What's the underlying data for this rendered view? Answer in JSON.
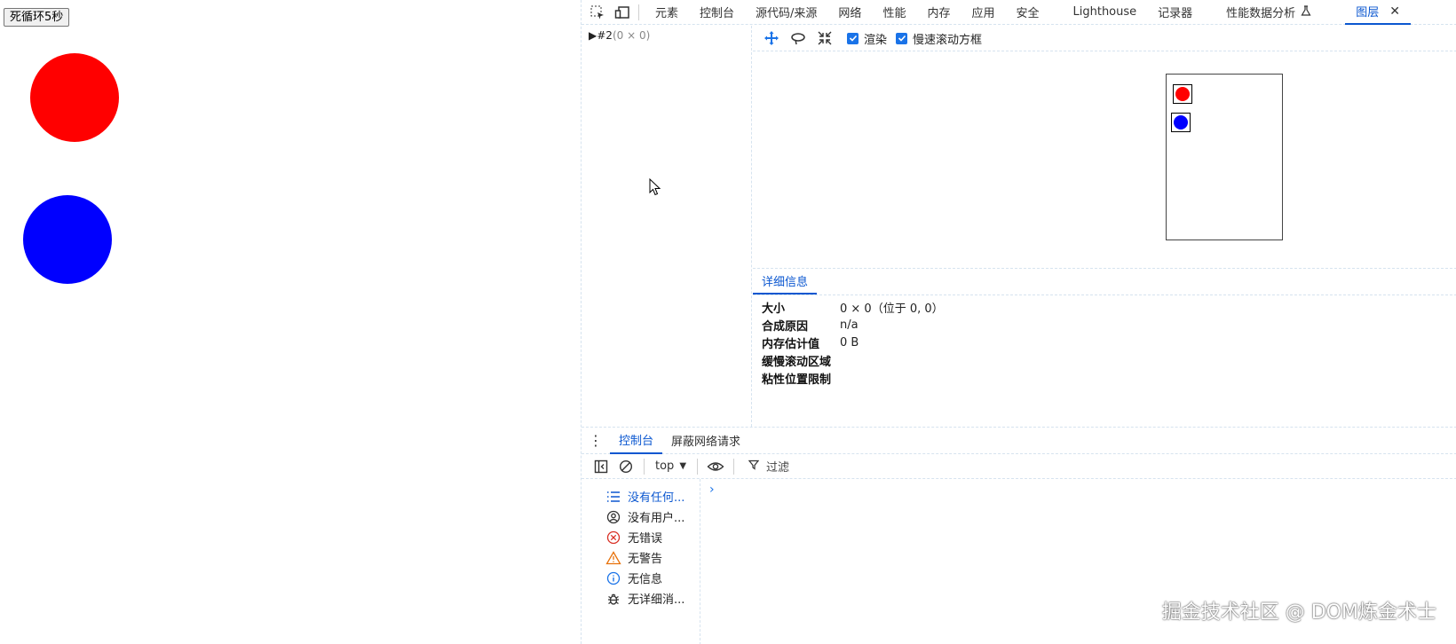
{
  "page": {
    "loop_button": "死循环5秒"
  },
  "devtools": {
    "tabs": [
      {
        "label": "元素"
      },
      {
        "label": "控制台"
      },
      {
        "label": "源代码/来源"
      },
      {
        "label": "网络"
      },
      {
        "label": "性能"
      },
      {
        "label": "内存"
      },
      {
        "label": "应用"
      },
      {
        "label": "安全"
      },
      {
        "label": "Lighthouse"
      },
      {
        "label": "记录器"
      },
      {
        "label": "性能数据分析"
      },
      {
        "label": "图层"
      }
    ],
    "active_tab": "图层",
    "layer_tree": {
      "node_name": "#2",
      "node_size": "(0 × 0)"
    },
    "viewer": {
      "checkbox_paint": "渲染",
      "checkbox_slow_scroll": "慢速滚动方框",
      "paint_checked": true,
      "slow_scroll_checked": true
    },
    "details": {
      "tab_label": "详细信息",
      "rows": [
        {
          "key": "大小",
          "value": "0 × 0（位于 0, 0）"
        },
        {
          "key": "合成原因",
          "value": "n/a"
        },
        {
          "key": "内存估计值",
          "value": "0 B"
        },
        {
          "key": "缓慢滚动区域",
          "value": ""
        },
        {
          "key": "粘性位置限制",
          "value": ""
        }
      ]
    },
    "drawer": {
      "tabs": [
        {
          "label": "控制台"
        },
        {
          "label": "屏蔽网络请求"
        }
      ],
      "context": "top",
      "filter_label": "过滤",
      "sidebar": [
        {
          "label": "没有任何..."
        },
        {
          "label": "没有用户..."
        },
        {
          "label": "无错误"
        },
        {
          "label": "无警告"
        },
        {
          "label": "无信息"
        },
        {
          "label": "无详细消..."
        }
      ]
    }
  },
  "watermark": "掘金技术社区 @ DOM炼金术士",
  "colors": {
    "accent": "#0b57d0",
    "red_circle": "#ff0000",
    "blue_circle": "#0000ff"
  }
}
